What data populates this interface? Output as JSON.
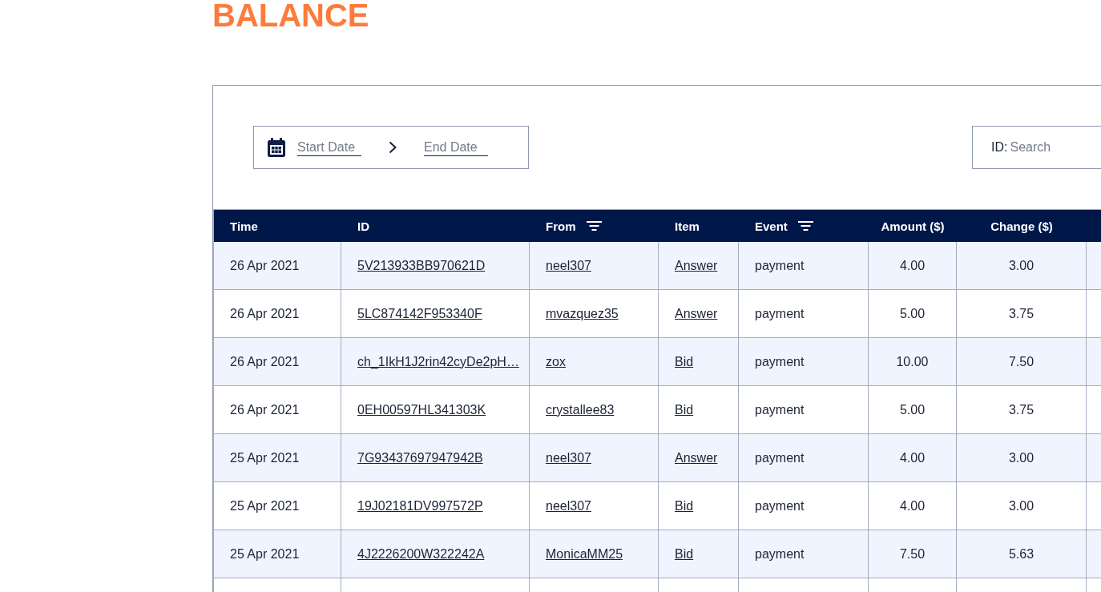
{
  "page": {
    "title": "BALANCE"
  },
  "date_range": {
    "start": {
      "placeholder": "Start Date"
    },
    "end": {
      "placeholder": "End Date"
    }
  },
  "id_search": {
    "label": "ID:",
    "placeholder": "Search"
  },
  "table": {
    "columns": [
      {
        "label": "Time",
        "kind": "text",
        "filter": false
      },
      {
        "label": "ID",
        "kind": "link",
        "filter": false
      },
      {
        "label": "From",
        "kind": "link",
        "filter": true
      },
      {
        "label": "Item",
        "kind": "link",
        "filter": false
      },
      {
        "label": "Event",
        "kind": "text",
        "filter": true
      },
      {
        "label": "Amount ($)",
        "kind": "number",
        "filter": false
      },
      {
        "label": "Change ($)",
        "kind": "number",
        "filter": false
      }
    ],
    "rows": [
      {
        "cells": [
          "26 Apr 2021",
          "5V213933BB970621D",
          "neel307",
          "Answer",
          "payment",
          "4.00",
          "3.00"
        ]
      },
      {
        "cells": [
          "26 Apr 2021",
          "5LC874142F953340F",
          "mvazquez35",
          "Answer",
          "payment",
          "5.00",
          "3.75"
        ]
      },
      {
        "cells": [
          "26 Apr 2021",
          "ch_1IkH1J2rin42cyDe2pH…",
          "zox",
          "Bid",
          "payment",
          "10.00",
          "7.50"
        ]
      },
      {
        "cells": [
          "26 Apr 2021",
          "0EH00597HL341303K",
          "crystallee83",
          "Bid",
          "payment",
          "5.00",
          "3.75"
        ]
      },
      {
        "cells": [
          "25 Apr 2021",
          "7G93437697947942B",
          "neel307",
          "Answer",
          "payment",
          "4.00",
          "3.00"
        ]
      },
      {
        "cells": [
          "25 Apr 2021",
          "19J02181DV997572P",
          "neel307",
          "Bid",
          "payment",
          "4.00",
          "3.00"
        ]
      },
      {
        "cells": [
          "25 Apr 2021",
          "4J2226200W322242A",
          "MonicaMM25",
          "Bid",
          "payment",
          "7.50",
          "5.63"
        ]
      }
    ]
  }
}
